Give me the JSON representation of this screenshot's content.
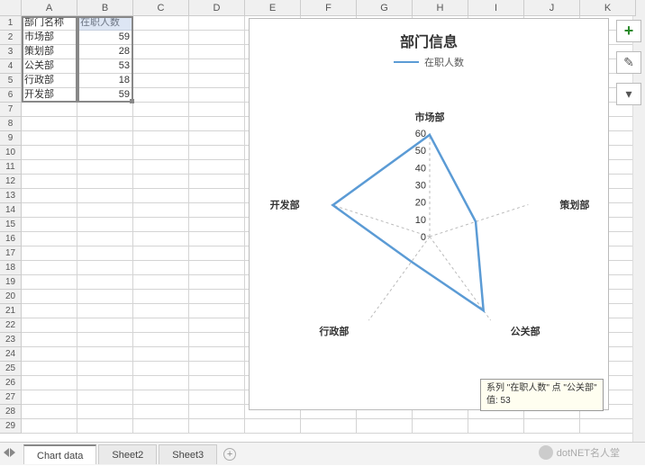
{
  "columns": [
    "A",
    "B",
    "C",
    "D",
    "E",
    "F",
    "G",
    "H",
    "I",
    "J",
    "K"
  ],
  "row_count": 29,
  "table": {
    "headers": [
      "部门名称",
      "在职人数"
    ],
    "rows": [
      {
        "name": "市场部",
        "count": 59
      },
      {
        "name": "策划部",
        "count": 28
      },
      {
        "name": "公关部",
        "count": 53
      },
      {
        "name": "行政部",
        "count": 18
      },
      {
        "name": "开发部",
        "count": 59
      }
    ]
  },
  "chart_data": {
    "type": "radar",
    "title": "部门信息",
    "series_name": "在职人数",
    "categories": [
      "市场部",
      "策划部",
      "公关部",
      "行政部",
      "开发部"
    ],
    "values": [
      59,
      28,
      53,
      18,
      59
    ],
    "ticks": [
      0,
      10,
      20,
      30,
      40,
      50,
      60
    ],
    "max": 60,
    "color": "#5b9bd5"
  },
  "tooltip": {
    "line1": "系列 \"在职人数\" 点 \"公关部\"",
    "line2": "值: 53"
  },
  "tabs": {
    "items": [
      "Chart data",
      "Sheet2",
      "Sheet3"
    ],
    "active": 0,
    "add_label": "+"
  },
  "side": {
    "plus": "+",
    "brush": "✎",
    "funnel": "▾"
  },
  "watermark": "dotNET名人堂"
}
